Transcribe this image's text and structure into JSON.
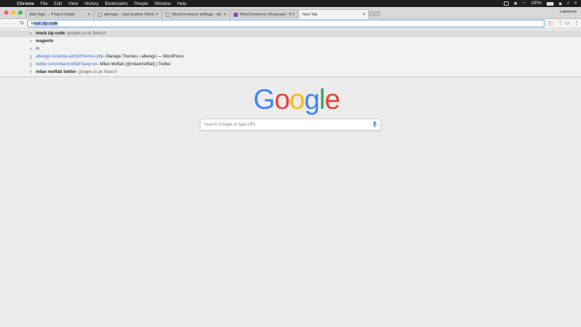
{
  "menubar": {
    "app": "Chrome",
    "items": [
      "File",
      "Edit",
      "View",
      "History",
      "Bookmarks",
      "People",
      "Window",
      "Help"
    ],
    "battery": "100%"
  },
  "tabs": [
    {
      "title": "Alter Ego → Project Guide",
      "icon": "page-icon"
    },
    {
      "title": "alterego – Just another Word…",
      "icon": "page-icon"
    },
    {
      "title": "WooCommerce settings ‹ alt…",
      "icon": "page-icon"
    },
    {
      "title": "WooCommerce Showcase - W…",
      "icon": "woocommerce-icon"
    },
    {
      "title": "New Tab",
      "icon": "none"
    }
  ],
  "profile_name": "Lawrence",
  "omnibox": {
    "typed": "m",
    "completion": "ock zip code"
  },
  "suggestions": [
    {
      "icon": "search-icon",
      "bold": "mock zip code",
      "url": "",
      "rest": " - google.co.uk Search"
    },
    {
      "icon": "search-icon",
      "bold": "magento",
      "url": "",
      "rest": ""
    },
    {
      "icon": "search-icon",
      "bold": "",
      "url": "",
      "rest": "m"
    },
    {
      "icon": "page-icon",
      "bold": "",
      "url": "alterego.local/wp-admin/themes.php",
      "rest": " - Manage Themes ‹ alterego — WordPress"
    },
    {
      "icon": "page-icon",
      "bold": "",
      "url": "twitter.com/milanmoffatt?lang=en",
      "rest": " - Milan Moffatt (@milanmoffatt) | Twitter"
    },
    {
      "icon": "search-icon",
      "bold": "milan moffatt twitter",
      "url": "",
      "rest": " - google.co.uk Search"
    }
  ],
  "logo_letters": [
    {
      "ch": "G",
      "color": "#4285f4"
    },
    {
      "ch": "o",
      "color": "#ea4335"
    },
    {
      "ch": "o",
      "color": "#fbbc05"
    },
    {
      "ch": "g",
      "color": "#4285f4"
    },
    {
      "ch": "l",
      "color": "#34a853"
    },
    {
      "ch": "e",
      "color": "#ea4335"
    }
  ],
  "search_placeholder": "Search Google or type URL"
}
